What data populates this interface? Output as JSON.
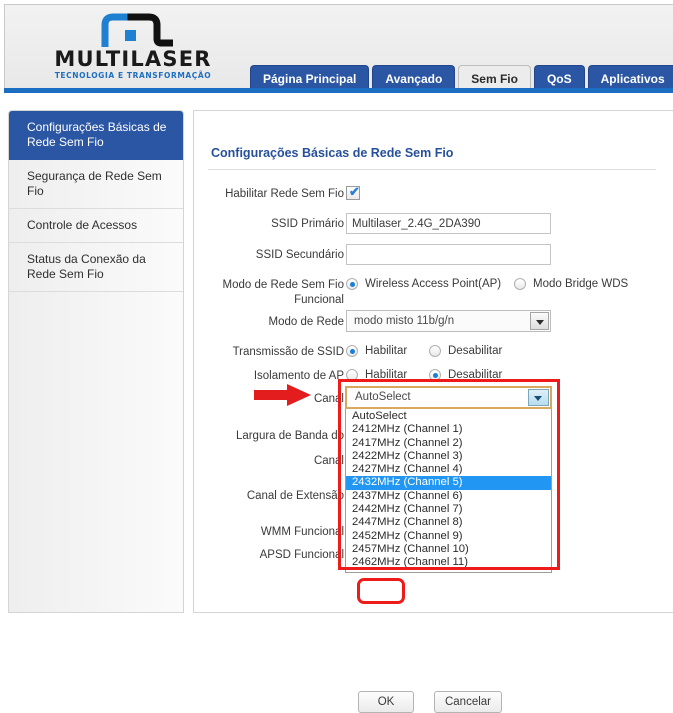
{
  "brand": {
    "name": "MULTILASER",
    "tagline": "TECNOLOGIA E TRANSFORMAÇÃO",
    "logo_icon": "multilaser-logo-icon"
  },
  "nav": {
    "tabs": [
      {
        "label": "Página Principal",
        "active": false
      },
      {
        "label": "Avançado",
        "active": false
      },
      {
        "label": "Sem Fio",
        "active": true
      },
      {
        "label": "QoS",
        "active": false
      },
      {
        "label": "Aplicativos",
        "active": false
      }
    ]
  },
  "sidebar": {
    "items": [
      {
        "label": "Configurações Básicas de Rede Sem Fio",
        "active": true
      },
      {
        "label": "Segurança de Rede Sem Fio",
        "active": false
      },
      {
        "label": "Controle de Acessos",
        "active": false
      },
      {
        "label": "Status da Conexão da Rede Sem Fio",
        "active": false
      }
    ]
  },
  "content": {
    "title": "Configurações Básicas de Rede Sem Fio",
    "fields": {
      "enable_wireless_label": "Habilitar Rede Sem Fio",
      "enable_wireless_checked": "✔",
      "ssid_primary_label": "SSID Primário",
      "ssid_primary_value": "Multilaser_2.4G_2DA390",
      "ssid_secondary_label": "SSID Secundário",
      "ssid_secondary_value": "",
      "mode_label_line1": "Modo de Rede Sem Fio",
      "mode_label_line2": "Funcional",
      "mode_option_ap": "Wireless Access Point(AP)",
      "mode_option_wds": "Modo Bridge WDS",
      "network_mode_label": "Modo de Rede",
      "network_mode_value": "modo misto 11b/g/n",
      "ssid_broadcast_label": "Transmissão de SSID",
      "ap_isolation_label": "Isolamento de AP",
      "enable_text": "Habilitar",
      "disable_text": "Desabilitar",
      "channel_label": "Canal",
      "bandwidth_label_line1": "Largura de Banda do",
      "bandwidth_label_line2": "Canal",
      "extension_channel_label": "Canal de Extensão",
      "wmm_label": "WMM Funcional",
      "apsd_label": "APSD Funcional"
    },
    "channel_select": {
      "value": "AutoSelect",
      "selected_option": "2432MHz (Channel 5)",
      "options": [
        "AutoSelect",
        "2412MHz (Channel 1)",
        "2417MHz (Channel 2)",
        "2422MHz (Channel 3)",
        "2427MHz (Channel 4)",
        "2432MHz (Channel 5)",
        "2437MHz (Channel 6)",
        "2442MHz (Channel 7)",
        "2447MHz (Channel 8)",
        "2452MHz (Channel 9)",
        "2457MHz (Channel 10)",
        "2462MHz (Channel 11)"
      ]
    },
    "buttons": {
      "ok": "OK",
      "cancel": "Cancelar"
    }
  },
  "annotations": {
    "arrow_color": "#e31d1d",
    "highlight_color": "#ee1b1b",
    "selection_color": "#2196f3",
    "accent_blue": "#2b56a4"
  }
}
